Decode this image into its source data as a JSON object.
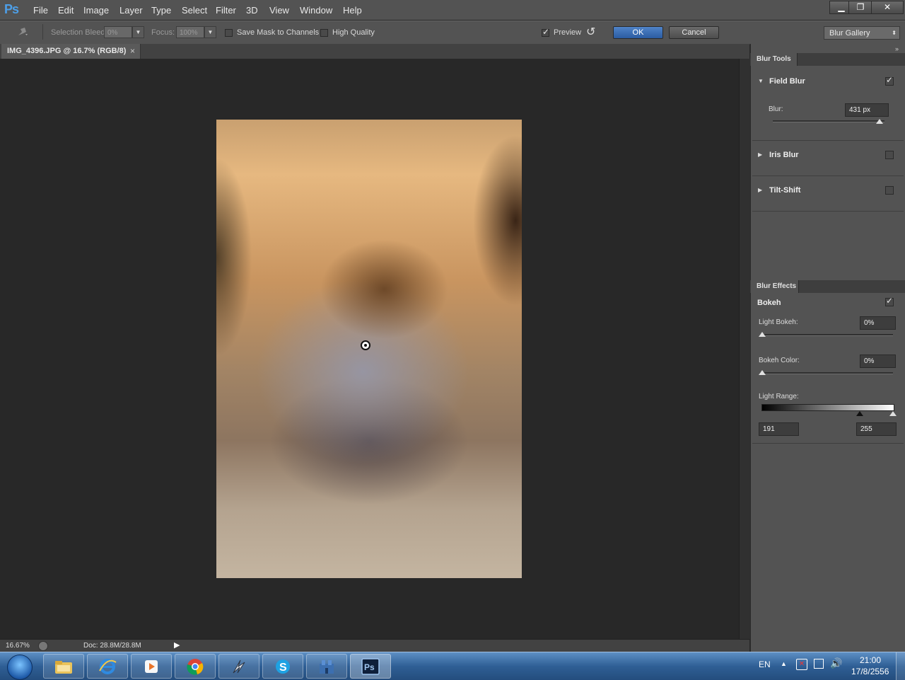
{
  "app": {
    "logo": "Ps"
  },
  "menu": [
    "File",
    "Edit",
    "Image",
    "Layer",
    "Type",
    "Select",
    "Filter",
    "3D",
    "View",
    "Window",
    "Help"
  ],
  "window_controls": {
    "minimize": "▁",
    "restore": "❐",
    "close": "✕"
  },
  "options_bar": {
    "selection_bleed_label": "Selection Bleed:",
    "selection_bleed_value": "0%",
    "focus_label": "Focus:",
    "focus_value": "100%",
    "save_mask_label": "Save Mask to Channels",
    "high_quality_label": "High Quality",
    "preview_label": "Preview",
    "preview_checked": true,
    "ok_label": "OK",
    "cancel_label": "Cancel",
    "workspace": "Blur Gallery"
  },
  "document": {
    "tab_title": "IMG_4396.JPG @ 16.7% (RGB/8)",
    "close_glyph": "×"
  },
  "status": {
    "zoom": "16.67%",
    "doc_size": "Doc: 28.8M/28.8M"
  },
  "blur_tools": {
    "tab_label": "Blur Tools",
    "field_blur": {
      "label": "Field Blur",
      "checked": true,
      "blur_label": "Blur:",
      "blur_value": "431 px"
    },
    "iris_blur": {
      "label": "Iris Blur",
      "checked": false
    },
    "tilt_shift": {
      "label": "Tilt-Shift",
      "checked": false
    }
  },
  "blur_effects": {
    "tab_label": "Blur Effects",
    "bokeh_label": "Bokeh",
    "bokeh_checked": true,
    "light_bokeh_label": "Light Bokeh:",
    "light_bokeh_value": "0%",
    "bokeh_color_label": "Bokeh Color:",
    "bokeh_color_value": "0%",
    "light_range_label": "Light Range:",
    "light_range_low": "191",
    "light_range_high": "255"
  },
  "taskbar": {
    "apps": [
      "file-explorer",
      "internet-explorer",
      "media-player",
      "chrome",
      "app-tool",
      "skype",
      "app-window",
      "photoshop"
    ],
    "lang": "EN",
    "time": "21:00",
    "date": "17/8/2556"
  },
  "colors": {
    "accent": "#2f62a8",
    "panel": "#535353",
    "canvas": "#282828"
  }
}
